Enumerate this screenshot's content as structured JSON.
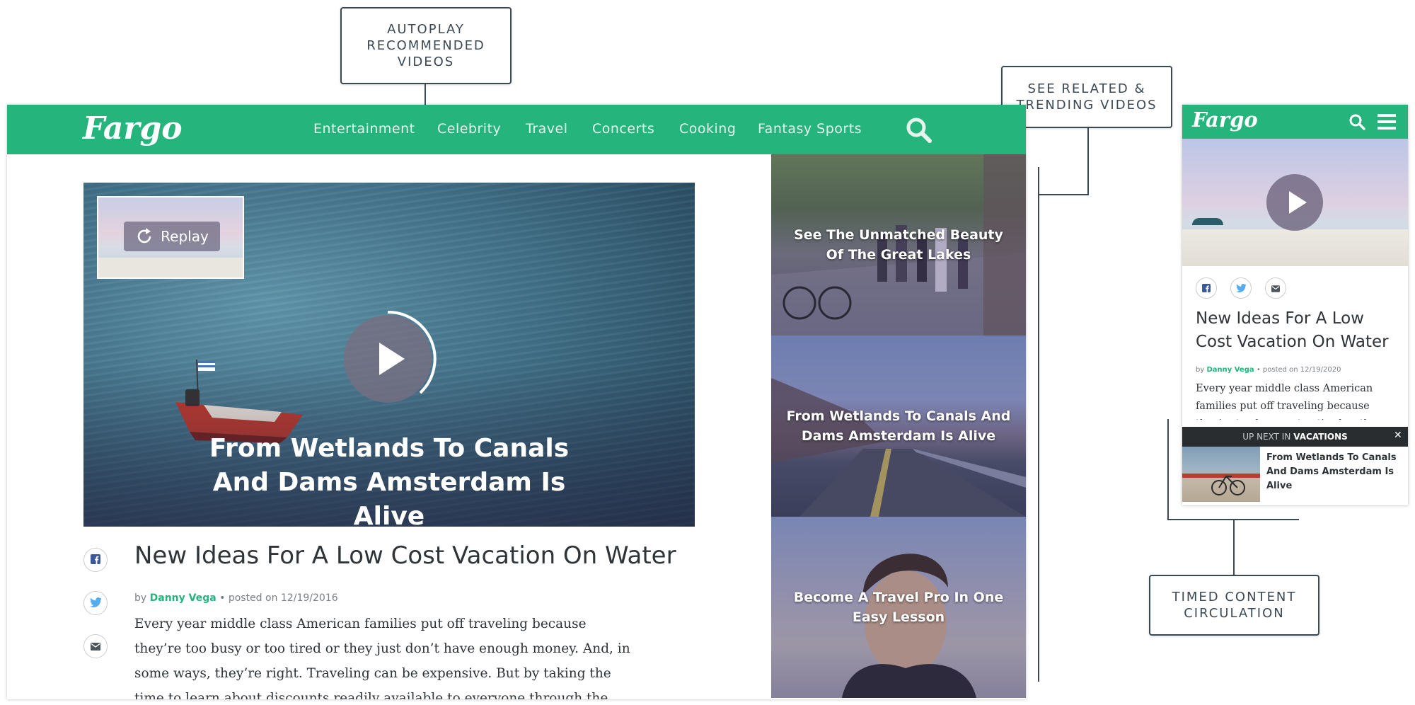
{
  "callouts": {
    "autoplay": "AUTOPLAY\nRECOMMENDED\nVIDEOS",
    "related": "SEE RELATED &\nTRENDING VIDEOS",
    "timed": "TIMED CONTENT\nCIRCULATION"
  },
  "site": {
    "logo": "Fargo",
    "nav": [
      "Entertainment",
      "Celebrity",
      "Travel",
      "Concerts",
      "Cooking",
      "Fantasy Sports"
    ]
  },
  "player": {
    "replay_label": "Replay",
    "overlay_title": "From Wetlands To Canals And Dams Amsterdam Is Alive"
  },
  "article": {
    "title": "New Ideas For A Low Cost Vacation On Water",
    "by": "by",
    "author": "Danny Vega",
    "posted": "• posted on 12/19/2016",
    "body": "Every year middle class American families put off traveling because they’re too busy or too tired or they just don’t have enough money. And, in some ways, they’re right. Traveling can be expensive. But by taking the time to learn about discounts readily available to everyone through the internet, newspapers, and"
  },
  "related": [
    {
      "title": "See The Unmatched Beauty Of The Great Lakes"
    },
    {
      "title": "From Wetlands To Canals And Dams Amsterdam Is Alive"
    },
    {
      "title": "Become A Travel Pro In One Easy Lesson"
    }
  ],
  "mobile": {
    "logo": "Fargo",
    "title": "New Ideas For A Low Cost Vacation On Water",
    "by": "by",
    "author": "Danny Vega",
    "posted": "• posted on 12/19/2020",
    "body": "Every year middle class American families put off traveling because they’re too busy or too tired or they just",
    "up_next_prefix": "UP NEXT IN",
    "up_next_category": "VACATIONS",
    "up_next_close": "✕",
    "up_next_title": "From Wetlands To Canals And Dams Amsterdam Is Alive"
  },
  "colors": {
    "brand_green": "#25b47c",
    "text_dark": "#2f3438",
    "callout_border": "#3c4852"
  }
}
